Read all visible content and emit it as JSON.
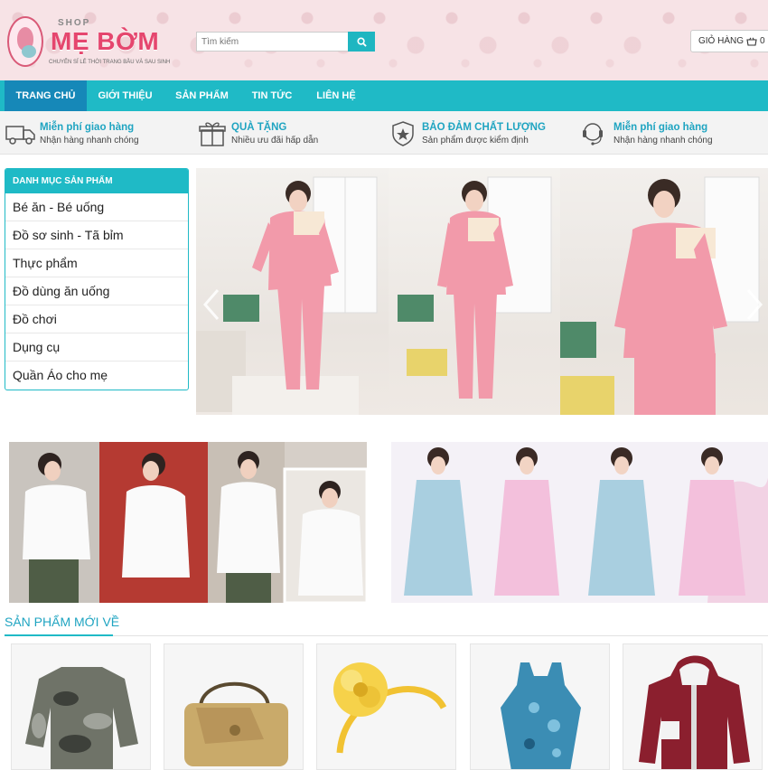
{
  "header": {
    "logo": {
      "shop": "SHOP",
      "name": "MẸ BỜM",
      "tagline": "CHUYÊN SỈ LẺ THỜI TRANG BẦU VÀ SAU SINH"
    },
    "search": {
      "placeholder": "Tìm kiếm",
      "icon": "search-icon"
    },
    "cart": {
      "label": "GIỎ HÀNG",
      "count": "0",
      "icon": "basket-icon"
    }
  },
  "nav": {
    "items": [
      {
        "label": "TRANG CHỦ",
        "active": true
      },
      {
        "label": "GIỚI THIỆU",
        "active": false
      },
      {
        "label": "SẢN PHẨM",
        "active": false
      },
      {
        "label": "TIN TỨC",
        "active": false
      },
      {
        "label": "LIÊN HỆ",
        "active": false
      }
    ]
  },
  "benefits": [
    {
      "icon": "truck-icon",
      "title": "Miễn phí giao hàng",
      "subtitle": "Nhận hàng nhanh chóng"
    },
    {
      "icon": "gift-icon",
      "title": "QUÀ TẶNG",
      "subtitle": "Nhiều ưu đãi hấp dẫn"
    },
    {
      "icon": "shield-badge-icon",
      "title": "BẢO ĐẢM CHẤT LƯỢNG",
      "subtitle": "Sản phẩm được kiểm định"
    },
    {
      "icon": "headset-icon",
      "title": "Miễn phí giao hàng",
      "subtitle": "Nhận hàng nhanh chóng"
    }
  ],
  "sidebar": {
    "title": "DANH MỤC SẢN PHẨM",
    "items": [
      {
        "label": "Bé ăn - Bé uống"
      },
      {
        "label": "Đồ sơ sinh - Tã bỉm"
      },
      {
        "label": "Thực phẩm"
      },
      {
        "label": "Đồ dùng ăn uống"
      },
      {
        "label": "Đồ chơi"
      },
      {
        "label": "Dụng cụ"
      },
      {
        "label": "Quần Áo cho mẹ"
      }
    ]
  },
  "slider": {
    "prev_icon": "chevron-left-icon",
    "next_icon": "chevron-right-icon"
  },
  "section": {
    "title": "SẢN PHẨM MỚI VỀ"
  },
  "colors": {
    "accent": "#1fbac6",
    "nav_active": "#1688b8",
    "brand_pink": "#e5466e",
    "benefit_title": "#1fa4c1"
  }
}
